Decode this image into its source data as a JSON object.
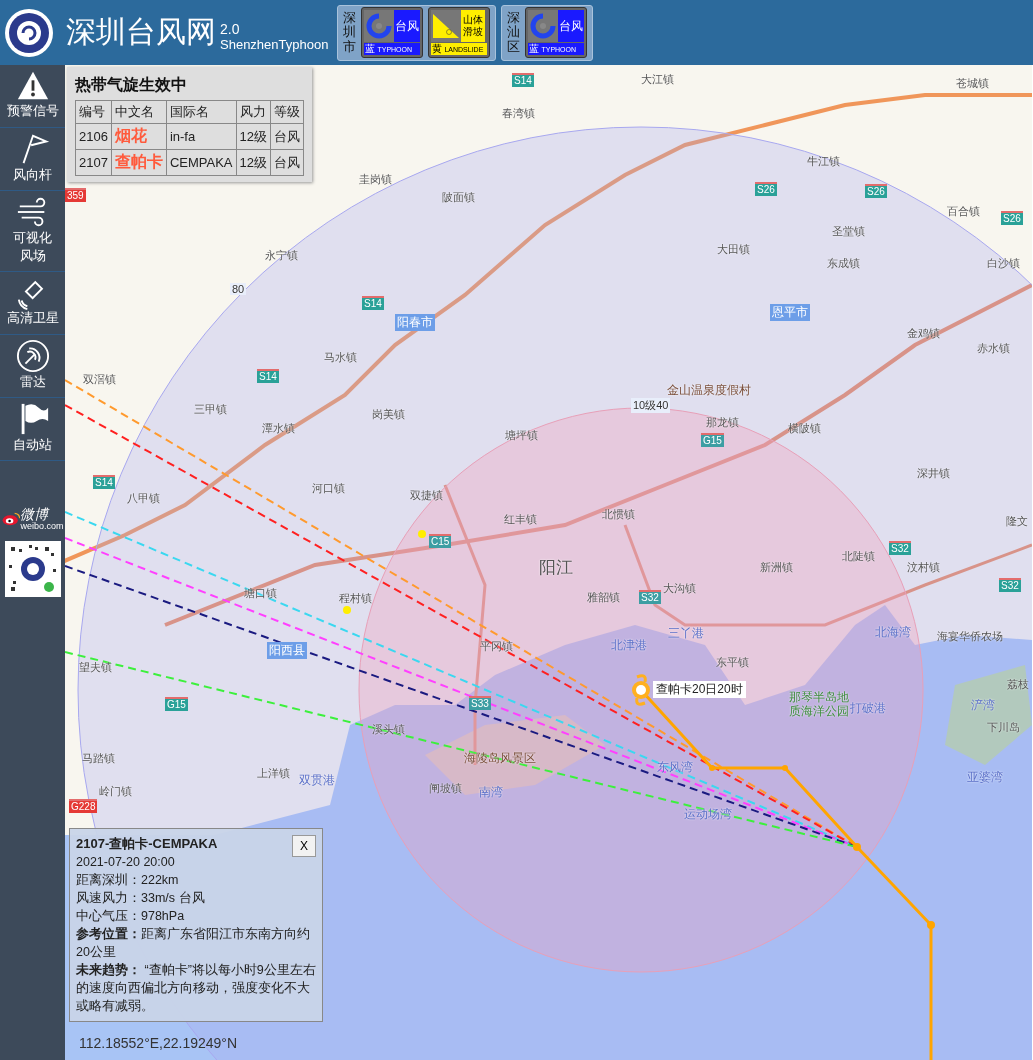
{
  "header": {
    "title": "深圳台风网",
    "version": "2.0",
    "subtitle": "ShenzhenTyphoon",
    "warning_groups": [
      {
        "region": "深圳市",
        "signals": [
          {
            "kind": "typhoon",
            "name": "台风",
            "level": "蓝",
            "code": "TYPHOON",
            "color": "#1a1aff"
          },
          {
            "kind": "landslide",
            "name": "山体滑坡",
            "level": "黄",
            "code": "LANDSLIDE",
            "color": "#ffee00"
          }
        ]
      },
      {
        "region": "深汕区",
        "signals": [
          {
            "kind": "typhoon",
            "name": "台风",
            "level": "蓝",
            "code": "TYPHOON",
            "color": "#1a1aff"
          }
        ]
      }
    ]
  },
  "sidebar": {
    "items": [
      {
        "kind": "warning",
        "label": "预警信号"
      },
      {
        "kind": "windbarb",
        "label": "风向杆"
      },
      {
        "kind": "windfield",
        "label": "可视化风场"
      },
      {
        "kind": "satellite",
        "label": "高清卫星"
      },
      {
        "kind": "radar",
        "label": "雷达"
      },
      {
        "kind": "station",
        "label": "自动站"
      }
    ],
    "weibo": {
      "text": "微博",
      "sub": "weibo.com"
    }
  },
  "cyclone_table": {
    "title": "热带气旋生效中",
    "columns": [
      "编号",
      "中文名",
      "国际名",
      "风力",
      "等级"
    ],
    "rows": [
      [
        "2106",
        "烟花",
        "in-fa",
        "12级",
        "台风"
      ],
      [
        "2107",
        "查帕卡",
        "CEMPAKA",
        "12级",
        "台风"
      ]
    ]
  },
  "map": {
    "labels": [
      {
        "text": "大江镇",
        "kind": "place"
      },
      {
        "text": "苍城镇",
        "kind": "place"
      },
      {
        "text": "春湾镇",
        "kind": "place"
      },
      {
        "text": "圭岗镇",
        "kind": "place"
      },
      {
        "text": "陂面镇",
        "kind": "place"
      },
      {
        "text": "牛江镇",
        "kind": "place"
      },
      {
        "text": "百合镇",
        "kind": "place"
      },
      {
        "text": "永宁镇",
        "kind": "place"
      },
      {
        "text": "大田镇",
        "kind": "place"
      },
      {
        "text": "圣堂镇",
        "kind": "place"
      },
      {
        "text": "白沙镇",
        "kind": "place"
      },
      {
        "text": "东成镇",
        "kind": "place"
      },
      {
        "text": "80",
        "kind": "tag"
      },
      {
        "text": "阳春市",
        "kind": "city"
      },
      {
        "text": "恩平市",
        "kind": "city"
      },
      {
        "text": "金鸡镇",
        "kind": "place"
      },
      {
        "text": "马水镇",
        "kind": "place"
      },
      {
        "text": "赤水镇",
        "kind": "place"
      },
      {
        "text": "双滘镇",
        "kind": "place"
      },
      {
        "text": "岗美镇",
        "kind": "place"
      },
      {
        "text": "金山温泉度假村",
        "kind": "poi"
      },
      {
        "text": "10级40",
        "kind": "tag"
      },
      {
        "text": "三甲镇",
        "kind": "place"
      },
      {
        "text": "潭水镇",
        "kind": "place"
      },
      {
        "text": "那龙镇",
        "kind": "place"
      },
      {
        "text": "横陂镇",
        "kind": "place"
      },
      {
        "text": "塘坪镇",
        "kind": "place"
      },
      {
        "text": "深井镇",
        "kind": "place"
      },
      {
        "text": "河口镇",
        "kind": "place"
      },
      {
        "text": "双捷镇",
        "kind": "place"
      },
      {
        "text": "八甲镇",
        "kind": "place"
      },
      {
        "text": "红丰镇",
        "kind": "place"
      },
      {
        "text": "北惯镇",
        "kind": "place"
      },
      {
        "text": "隆文",
        "kind": "place"
      },
      {
        "text": "北陡镇",
        "kind": "place"
      },
      {
        "text": "阳江",
        "kind": "capital"
      },
      {
        "text": "新洲镇",
        "kind": "place"
      },
      {
        "text": "汶村镇",
        "kind": "place"
      },
      {
        "text": "塘口镇",
        "kind": "place"
      },
      {
        "text": "程村镇",
        "kind": "place"
      },
      {
        "text": "大沟镇",
        "kind": "place"
      },
      {
        "text": "雅韶镇",
        "kind": "place"
      },
      {
        "text": "北海湾",
        "kind": "water"
      },
      {
        "text": "平冈镇",
        "kind": "place"
      },
      {
        "text": "北津港",
        "kind": "water"
      },
      {
        "text": "三丫港",
        "kind": "water"
      },
      {
        "text": "海宴华侨农场",
        "kind": "place"
      },
      {
        "text": "阳西县",
        "kind": "city"
      },
      {
        "text": "望夫镇",
        "kind": "place"
      },
      {
        "text": "东平镇",
        "kind": "place"
      },
      {
        "text": "那琴半岛地质海洋公园",
        "kind": "park"
      },
      {
        "text": "打破港",
        "kind": "water"
      },
      {
        "text": "荔枝",
        "kind": "place"
      },
      {
        "text": "浐湾",
        "kind": "water"
      },
      {
        "text": "下川岛",
        "kind": "place"
      },
      {
        "text": "溪头镇",
        "kind": "place"
      },
      {
        "text": "海陵岛风景区",
        "kind": "poi"
      },
      {
        "text": "东风湾",
        "kind": "water"
      },
      {
        "text": "上洋镇",
        "kind": "place"
      },
      {
        "text": "双贯港",
        "kind": "water"
      },
      {
        "text": "亚婆湾",
        "kind": "water"
      },
      {
        "text": "闸坡镇",
        "kind": "place"
      },
      {
        "text": "南湾",
        "kind": "water"
      },
      {
        "text": "马踏镇",
        "kind": "place"
      },
      {
        "text": "岭门镇",
        "kind": "place"
      },
      {
        "text": "运动场湾",
        "kind": "water"
      }
    ],
    "shields": [
      {
        "text": "S14",
        "color": "#2aa198"
      },
      {
        "text": "S26",
        "color": "#2aa198"
      },
      {
        "text": "S26",
        "color": "#2aa198"
      },
      {
        "text": "S26",
        "color": "#2aa198"
      },
      {
        "text": "S14",
        "color": "#2aa198"
      },
      {
        "text": "S14",
        "color": "#2aa198"
      },
      {
        "text": "G15",
        "color": "#3d9ea3"
      },
      {
        "text": "S14",
        "color": "#2aa198"
      },
      {
        "text": "C15",
        "color": "#3d9ea3"
      },
      {
        "text": "S32",
        "color": "#3d9ea3"
      },
      {
        "text": "S32",
        "color": "#2aa198"
      },
      {
        "text": "S32",
        "color": "#2aa198"
      },
      {
        "text": "G15",
        "color": "#2aa198"
      },
      {
        "text": "S33",
        "color": "#3d9ea3"
      },
      {
        "text": "G228",
        "color": "#e53935"
      },
      {
        "text": "359",
        "color": "#e53935"
      }
    ],
    "typhoon_label": "查帕卡20日20时",
    "coordinates": "112.18552°E,22.19249°N"
  },
  "info_panel": {
    "title": "2107-查帕卡-CEMPAKA",
    "time": "2021-07-20 20:00",
    "close": "X",
    "lines": [
      {
        "label": "距离深圳：",
        "value": "222km",
        "emphasis": false
      },
      {
        "label": "风速风力：",
        "value": "33m/s 台风",
        "emphasis": false
      },
      {
        "label": "中心气压：",
        "value": "978hPa",
        "emphasis": false
      },
      {
        "label": "参考位置：",
        "value": "距离广东省阳江市东南方向约20公里",
        "emphasis": true
      },
      {
        "label": "未来趋势：",
        "value": " “查帕卡”将以每小时9公里左右的速度向西偏北方向移动，强度变化不大或略有减弱。",
        "emphasis": true
      }
    ]
  }
}
